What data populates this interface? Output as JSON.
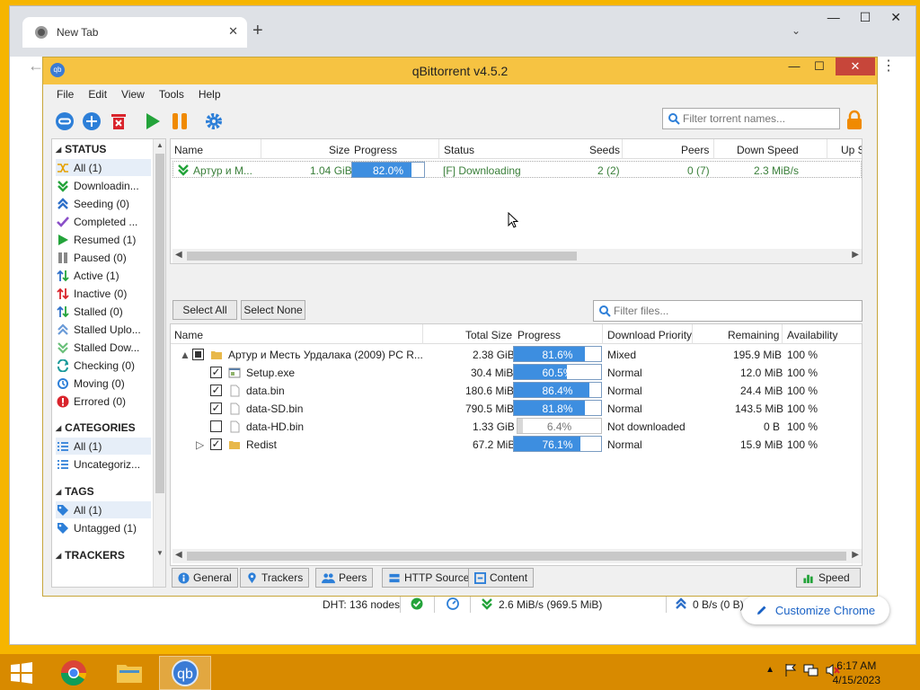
{
  "browser": {
    "tab_title": "New Tab",
    "tab_close": "✕",
    "new_tab": "+",
    "minimize": "—",
    "maximize": "☐",
    "close": "✕",
    "customize_label": "Customize Chrome"
  },
  "app": {
    "title": "qBittorrent v4.5.2",
    "logo": "qb"
  },
  "menu": [
    "File",
    "Edit",
    "View",
    "Tools",
    "Help"
  ],
  "search": {
    "placeholder": "Filter torrent names..."
  },
  "sidebar": {
    "status_header": "STATUS",
    "status_items": [
      {
        "label": "All (1)",
        "icon": "all-icon",
        "selected": true
      },
      {
        "label": "Downloadin...",
        "icon": "download-icon"
      },
      {
        "label": "Seeding (0)",
        "icon": "seeding-icon"
      },
      {
        "label": "Completed ...",
        "icon": "completed-icon"
      },
      {
        "label": "Resumed (1)",
        "icon": "resumed-icon"
      },
      {
        "label": "Paused (0)",
        "icon": "paused-icon"
      },
      {
        "label": "Active (1)",
        "icon": "active-icon"
      },
      {
        "label": "Inactive (0)",
        "icon": "inactive-icon"
      },
      {
        "label": "Stalled (0)",
        "icon": "stalled-icon"
      },
      {
        "label": "Stalled Uplo...",
        "icon": "stalled-upload-icon"
      },
      {
        "label": "Stalled Dow...",
        "icon": "stalled-download-icon"
      },
      {
        "label": "Checking (0)",
        "icon": "checking-icon"
      },
      {
        "label": "Moving (0)",
        "icon": "moving-icon"
      },
      {
        "label": "Errored (0)",
        "icon": "errored-icon"
      }
    ],
    "categories_header": "CATEGORIES",
    "category_items": [
      "All (1)",
      "Uncategoriz..."
    ],
    "tags_header": "TAGS",
    "tag_items": [
      "All (1)",
      "Untagged (1)"
    ],
    "trackers_header": "TRACKERS"
  },
  "torrent_table": {
    "columns": [
      "Name",
      "Size",
      "Progress",
      "Status",
      "Seeds",
      "Peers",
      "Down Speed",
      "Up S"
    ],
    "rows": [
      {
        "name": "Артур и М...",
        "size": "1.04 GiB",
        "progress": 0.82,
        "progress_text": "82.0%",
        "status": "[F] Downloading",
        "seeds": "2 (2)",
        "peers": "0 (7)",
        "down_speed": "2.3 MiB/s"
      }
    ]
  },
  "buttons": {
    "select_all": "Select All",
    "select_none": "Select None"
  },
  "filter_files": {
    "placeholder": "Filter files..."
  },
  "file_table": {
    "columns": [
      "Name",
      "Total Size",
      "Progress",
      "Download Priority",
      "Remaining",
      "Availability"
    ],
    "rows": [
      {
        "expander": "▲",
        "check": "partial",
        "icon": "folder-icon",
        "name": "Артур и Месть Урдалака  (2009) PC  R...",
        "size": "2.38 GiB",
        "progress": 0.816,
        "progress_text": "81.6%",
        "priority": "Mixed",
        "remaining": "195.9 MiB",
        "availability": "100 %"
      },
      {
        "check": "checked",
        "icon": "exe-icon",
        "name": "Setup.exe",
        "size": "30.4 MiB",
        "progress": 0.605,
        "progress_text": "60.5%",
        "priority": "Normal",
        "remaining": "12.0 MiB",
        "availability": "100 %"
      },
      {
        "check": "checked",
        "icon": "file-icon",
        "name": "data.bin",
        "size": "180.6 MiB",
        "progress": 0.864,
        "progress_text": "86.4%",
        "priority": "Normal",
        "remaining": "24.4 MiB",
        "availability": "100 %"
      },
      {
        "check": "checked",
        "icon": "file-icon",
        "name": "data-SD.bin",
        "size": "790.5 MiB",
        "progress": 0.818,
        "progress_text": "81.8%",
        "priority": "Normal",
        "remaining": "143.5 MiB",
        "availability": "100 %"
      },
      {
        "check": "unchecked",
        "icon": "file-icon",
        "name": "data-HD.bin",
        "size": "1.33 GiB",
        "progress": 0.064,
        "progress_text": "6.4%",
        "priority": "Not downloaded",
        "remaining": "0 B",
        "availability": "100 %"
      },
      {
        "expander": "▷",
        "check": "checked",
        "icon": "folder-icon",
        "name": "Redist",
        "size": "67.2 MiB",
        "progress": 0.761,
        "progress_text": "76.1%",
        "priority": "Normal",
        "remaining": "15.9 MiB",
        "availability": "100 %"
      }
    ]
  },
  "bottom_tabs": [
    "General",
    "Trackers",
    "Peers",
    "HTTP Sources",
    "Content"
  ],
  "speed_button": "Speed",
  "statusbar": {
    "dht": "DHT: 136 nodes",
    "download": "2.6 MiB/s (969.5 MiB)",
    "upload": "0 B/s (0 B)"
  },
  "taskbar": {
    "time": "6:17 AM",
    "date": "4/15/2023",
    "qb_label": "qb"
  },
  "colors": {
    "desktop": "#f6b500",
    "titlebar": "#f6c342",
    "progress_fill": "#3d8ee0",
    "downloading_text": "#3a7f3a"
  }
}
